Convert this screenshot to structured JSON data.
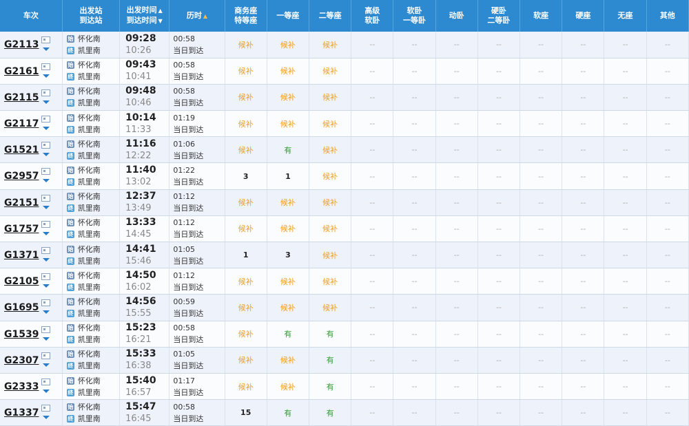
{
  "headers": {
    "train": "车次",
    "stations": [
      "出发站",
      "到达站"
    ],
    "times": [
      "出发时间",
      "到达时间"
    ],
    "duration": "历时",
    "seats": [
      [
        "商务座",
        "特等座"
      ],
      [
        "一等座"
      ],
      [
        "二等座"
      ],
      [
        "高级",
        "软卧"
      ],
      [
        "软卧",
        "一等卧"
      ],
      [
        "动卧"
      ],
      [
        "硬卧",
        "二等卧"
      ],
      [
        "软座"
      ],
      [
        "硬座"
      ],
      [
        "无座"
      ],
      [
        "其他"
      ]
    ]
  },
  "status_labels": {
    "houbu": "候补",
    "you": "有",
    "none": "--"
  },
  "rows": [
    {
      "train": "G2113",
      "from": "怀化南",
      "to": "凯里南",
      "dep": "09:28",
      "arr": "10:26",
      "dur": "00:58",
      "day": "当日到达",
      "seats": [
        "候补",
        "候补",
        "候补",
        "--",
        "--",
        "--",
        "--",
        "--",
        "--",
        "--",
        "--"
      ]
    },
    {
      "train": "G2161",
      "from": "怀化南",
      "to": "凯里南",
      "dep": "09:43",
      "arr": "10:41",
      "dur": "00:58",
      "day": "当日到达",
      "seats": [
        "候补",
        "候补",
        "候补",
        "--",
        "--",
        "--",
        "--",
        "--",
        "--",
        "--",
        "--"
      ]
    },
    {
      "train": "G2115",
      "from": "怀化南",
      "to": "凯里南",
      "dep": "09:48",
      "arr": "10:46",
      "dur": "00:58",
      "day": "当日到达",
      "seats": [
        "候补",
        "候补",
        "候补",
        "--",
        "--",
        "--",
        "--",
        "--",
        "--",
        "--",
        "--"
      ]
    },
    {
      "train": "G2117",
      "from": "怀化南",
      "to": "凯里南",
      "dep": "10:14",
      "arr": "11:33",
      "dur": "01:19",
      "day": "当日到达",
      "seats": [
        "候补",
        "候补",
        "候补",
        "--",
        "--",
        "--",
        "--",
        "--",
        "--",
        "--",
        "--"
      ]
    },
    {
      "train": "G1521",
      "from": "怀化南",
      "to": "凯里南",
      "dep": "11:16",
      "arr": "12:22",
      "dur": "01:06",
      "day": "当日到达",
      "seats": [
        "候补",
        "有",
        "候补",
        "--",
        "--",
        "--",
        "--",
        "--",
        "--",
        "--",
        "--"
      ]
    },
    {
      "train": "G2957",
      "from": "怀化南",
      "to": "凯里南",
      "dep": "11:40",
      "arr": "13:02",
      "dur": "01:22",
      "day": "当日到达",
      "seats": [
        "3",
        "1",
        "候补",
        "--",
        "--",
        "--",
        "--",
        "--",
        "--",
        "--",
        "--"
      ]
    },
    {
      "train": "G2151",
      "from": "怀化南",
      "to": "凯里南",
      "dep": "12:37",
      "arr": "13:49",
      "dur": "01:12",
      "day": "当日到达",
      "seats": [
        "候补",
        "候补",
        "候补",
        "--",
        "--",
        "--",
        "--",
        "--",
        "--",
        "--",
        "--"
      ]
    },
    {
      "train": "G1757",
      "from": "怀化南",
      "to": "凯里南",
      "dep": "13:33",
      "arr": "14:45",
      "dur": "01:12",
      "day": "当日到达",
      "seats": [
        "候补",
        "候补",
        "候补",
        "--",
        "--",
        "--",
        "--",
        "--",
        "--",
        "--",
        "--"
      ]
    },
    {
      "train": "G1371",
      "from": "怀化南",
      "to": "凯里南",
      "dep": "14:41",
      "arr": "15:46",
      "dur": "01:05",
      "day": "当日到达",
      "seats": [
        "1",
        "3",
        "候补",
        "--",
        "--",
        "--",
        "--",
        "--",
        "--",
        "--",
        "--"
      ]
    },
    {
      "train": "G2105",
      "from": "怀化南",
      "to": "凯里南",
      "dep": "14:50",
      "arr": "16:02",
      "dur": "01:12",
      "day": "当日到达",
      "seats": [
        "候补",
        "候补",
        "候补",
        "--",
        "--",
        "--",
        "--",
        "--",
        "--",
        "--",
        "--"
      ]
    },
    {
      "train": "G1695",
      "from": "怀化南",
      "to": "凯里南",
      "dep": "14:56",
      "arr": "15:55",
      "dur": "00:59",
      "day": "当日到达",
      "seats": [
        "候补",
        "候补",
        "候补",
        "--",
        "--",
        "--",
        "--",
        "--",
        "--",
        "--",
        "--"
      ]
    },
    {
      "train": "G1539",
      "from": "怀化南",
      "to": "凯里南",
      "dep": "15:23",
      "arr": "16:21",
      "dur": "00:58",
      "day": "当日到达",
      "seats": [
        "候补",
        "有",
        "有",
        "--",
        "--",
        "--",
        "--",
        "--",
        "--",
        "--",
        "--"
      ]
    },
    {
      "train": "G2307",
      "from": "怀化南",
      "to": "凯里南",
      "dep": "15:33",
      "arr": "16:38",
      "dur": "01:05",
      "day": "当日到达",
      "seats": [
        "候补",
        "候补",
        "有",
        "--",
        "--",
        "--",
        "--",
        "--",
        "--",
        "--",
        "--"
      ]
    },
    {
      "train": "G2333",
      "from": "怀化南",
      "to": "凯里南",
      "dep": "15:40",
      "arr": "16:57",
      "dur": "01:17",
      "day": "当日到达",
      "seats": [
        "候补",
        "候补",
        "有",
        "--",
        "--",
        "--",
        "--",
        "--",
        "--",
        "--",
        "--"
      ]
    },
    {
      "train": "G1337",
      "from": "怀化南",
      "to": "凯里南",
      "dep": "15:47",
      "arr": "16:45",
      "dur": "00:58",
      "day": "当日到达",
      "seats": [
        "15",
        "有",
        "有",
        "--",
        "--",
        "--",
        "--",
        "--",
        "--",
        "--",
        "--"
      ]
    }
  ],
  "colors": {
    "header_bg": "#2d8ad1",
    "houbu": "#f0a020",
    "you": "#2e9b2e",
    "row_alt": "#eef3fb"
  },
  "icons": {
    "train_card": "id-card-icon",
    "train_more": "chevron-down-icon",
    "from_station": "departure-station-icon",
    "to_station": "arrival-station-icon"
  }
}
